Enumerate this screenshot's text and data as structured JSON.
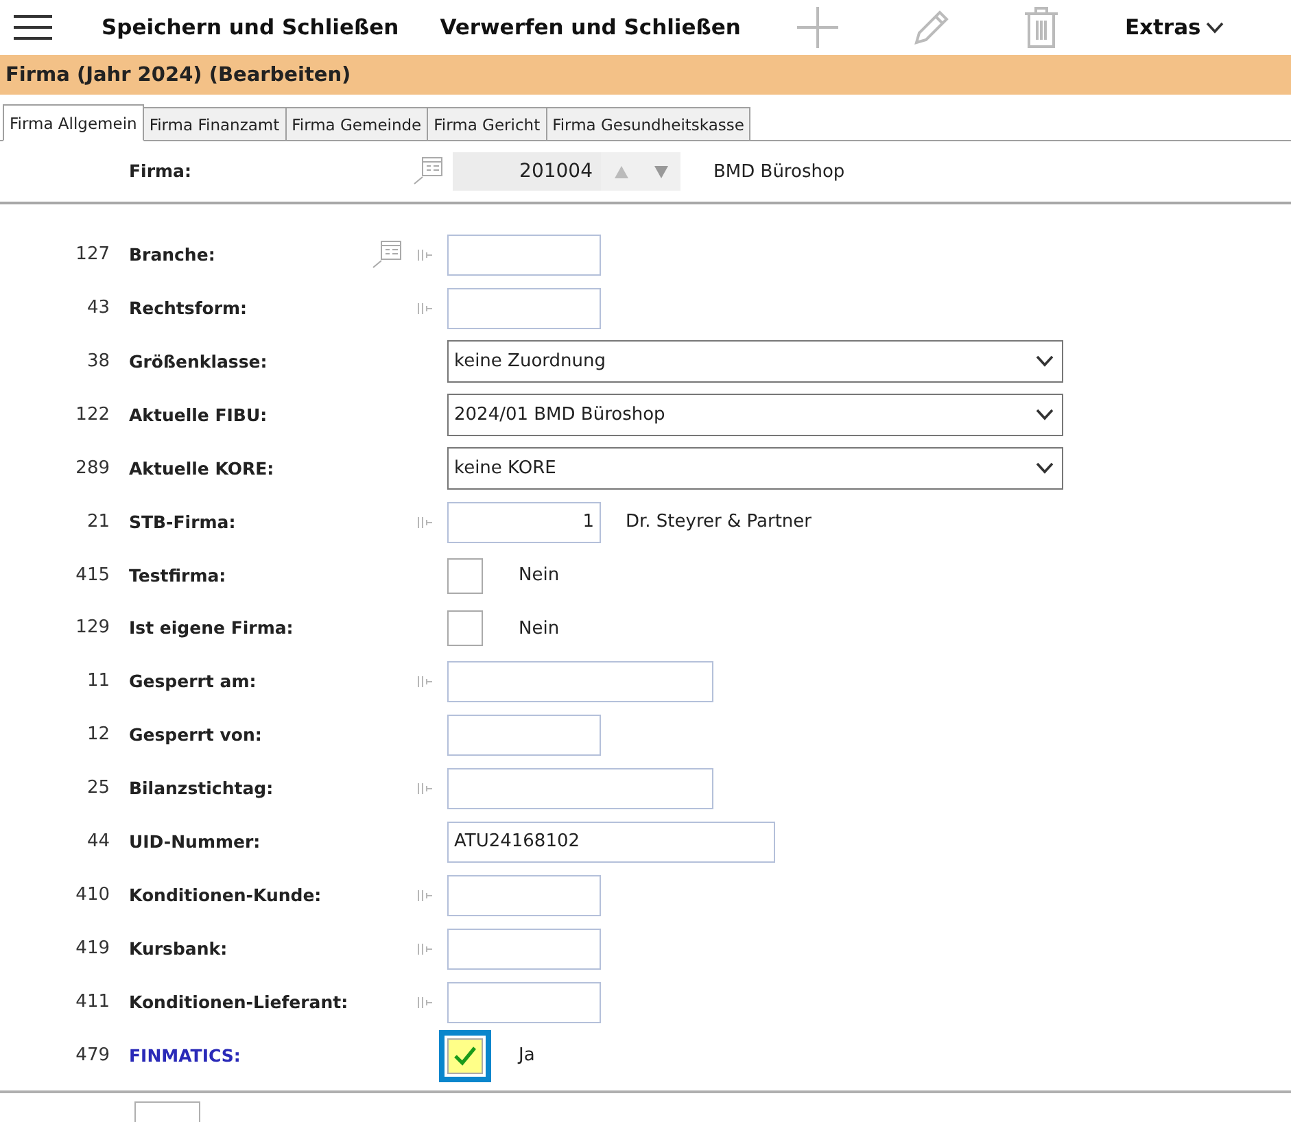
{
  "toolbar": {
    "buttons": [
      {
        "kind": "menu"
      },
      {
        "kind": "text",
        "label": "Speichern und Schließen"
      },
      {
        "kind": "text",
        "label": "Verwerfen und Schließen"
      },
      {
        "kind": "add",
        "disabled": true
      },
      {
        "kind": "edit",
        "disabled": true
      },
      {
        "kind": "delete",
        "disabled": true
      },
      {
        "kind": "dropdown",
        "label": "Extras"
      }
    ]
  },
  "window": {
    "title": "Firma (Jahr 2024) (Bearbeiten)"
  },
  "tabs": [
    {
      "label": "Firma Allgemein",
      "selected": true
    },
    {
      "label": "Firma Finanzamt",
      "selected": false
    },
    {
      "label": "Firma Gemeinde",
      "selected": false
    },
    {
      "label": "Firma Gericht",
      "selected": false
    },
    {
      "label": "Firma Gesundheitskasse",
      "selected": false
    }
  ],
  "firma": {
    "label": "Firma:",
    "value": "201004",
    "name": "BMD Büroshop"
  },
  "rows": [
    {
      "number": "127",
      "label": "Branche:",
      "kind": "short",
      "lookup": true,
      "marker": true,
      "highlighted": false
    },
    {
      "number": "43",
      "label": "Rechtsform:",
      "kind": "short",
      "lookup": false,
      "marker": true,
      "highlighted": false
    },
    {
      "number": "38",
      "label": "Größenklasse:",
      "kind": "select",
      "value": "keine Zuordnung",
      "lookup": false,
      "marker": false,
      "highlighted": false
    },
    {
      "number": "122",
      "label": "Aktuelle FIBU:",
      "kind": "select",
      "value": "2024/01 BMD Büroshop",
      "lookup": false,
      "marker": false,
      "highlighted": false
    },
    {
      "number": "289",
      "label": "Aktuelle KORE:",
      "kind": "select",
      "value": "keine KORE",
      "lookup": false,
      "marker": false,
      "highlighted": false
    },
    {
      "number": "21",
      "label": "STB-Firma:",
      "kind": "number",
      "value": "1",
      "note": "Dr. Steyrer & Partner",
      "lookup": false,
      "marker": true,
      "highlighted": false
    },
    {
      "number": "415",
      "label": "Testfirma:",
      "kind": "checkbox",
      "checked": false,
      "focused": false,
      "note": "Nein",
      "lookup": false,
      "marker": false,
      "highlighted": false
    },
    {
      "number": "129",
      "label": "Ist eigene Firma:",
      "kind": "checkbox",
      "checked": false,
      "focused": false,
      "note": "Nein",
      "lookup": false,
      "marker": false,
      "highlighted": false
    },
    {
      "number": "11",
      "label": "Gesperrt am:",
      "kind": "medium",
      "lookup": false,
      "marker": true,
      "highlighted": false
    },
    {
      "number": "12",
      "label": "Gesperrt von:",
      "kind": "short",
      "lookup": false,
      "marker": false,
      "highlighted": false
    },
    {
      "number": "25",
      "label": "Bilanzstichtag:",
      "kind": "medium",
      "lookup": false,
      "marker": true,
      "highlighted": false
    },
    {
      "number": "44",
      "label": "UID-Nummer:",
      "kind": "long",
      "value": "ATU24168102",
      "lookup": false,
      "marker": false,
      "highlighted": false
    },
    {
      "number": "410",
      "label": "Konditionen-Kunde:",
      "kind": "short",
      "lookup": false,
      "marker": true,
      "highlighted": false
    },
    {
      "number": "419",
      "label": "Kursbank:",
      "kind": "short",
      "lookup": false,
      "marker": true,
      "highlighted": false
    },
    {
      "number": "411",
      "label": "Konditionen-Lieferant:",
      "kind": "short",
      "lookup": false,
      "marker": true,
      "highlighted": false
    },
    {
      "number": "479",
      "label": "FINMATICS:",
      "kind": "checkbox",
      "checked": true,
      "focused": true,
      "note": "Ja",
      "lookup": false,
      "marker": false,
      "highlighted": true
    }
  ]
}
